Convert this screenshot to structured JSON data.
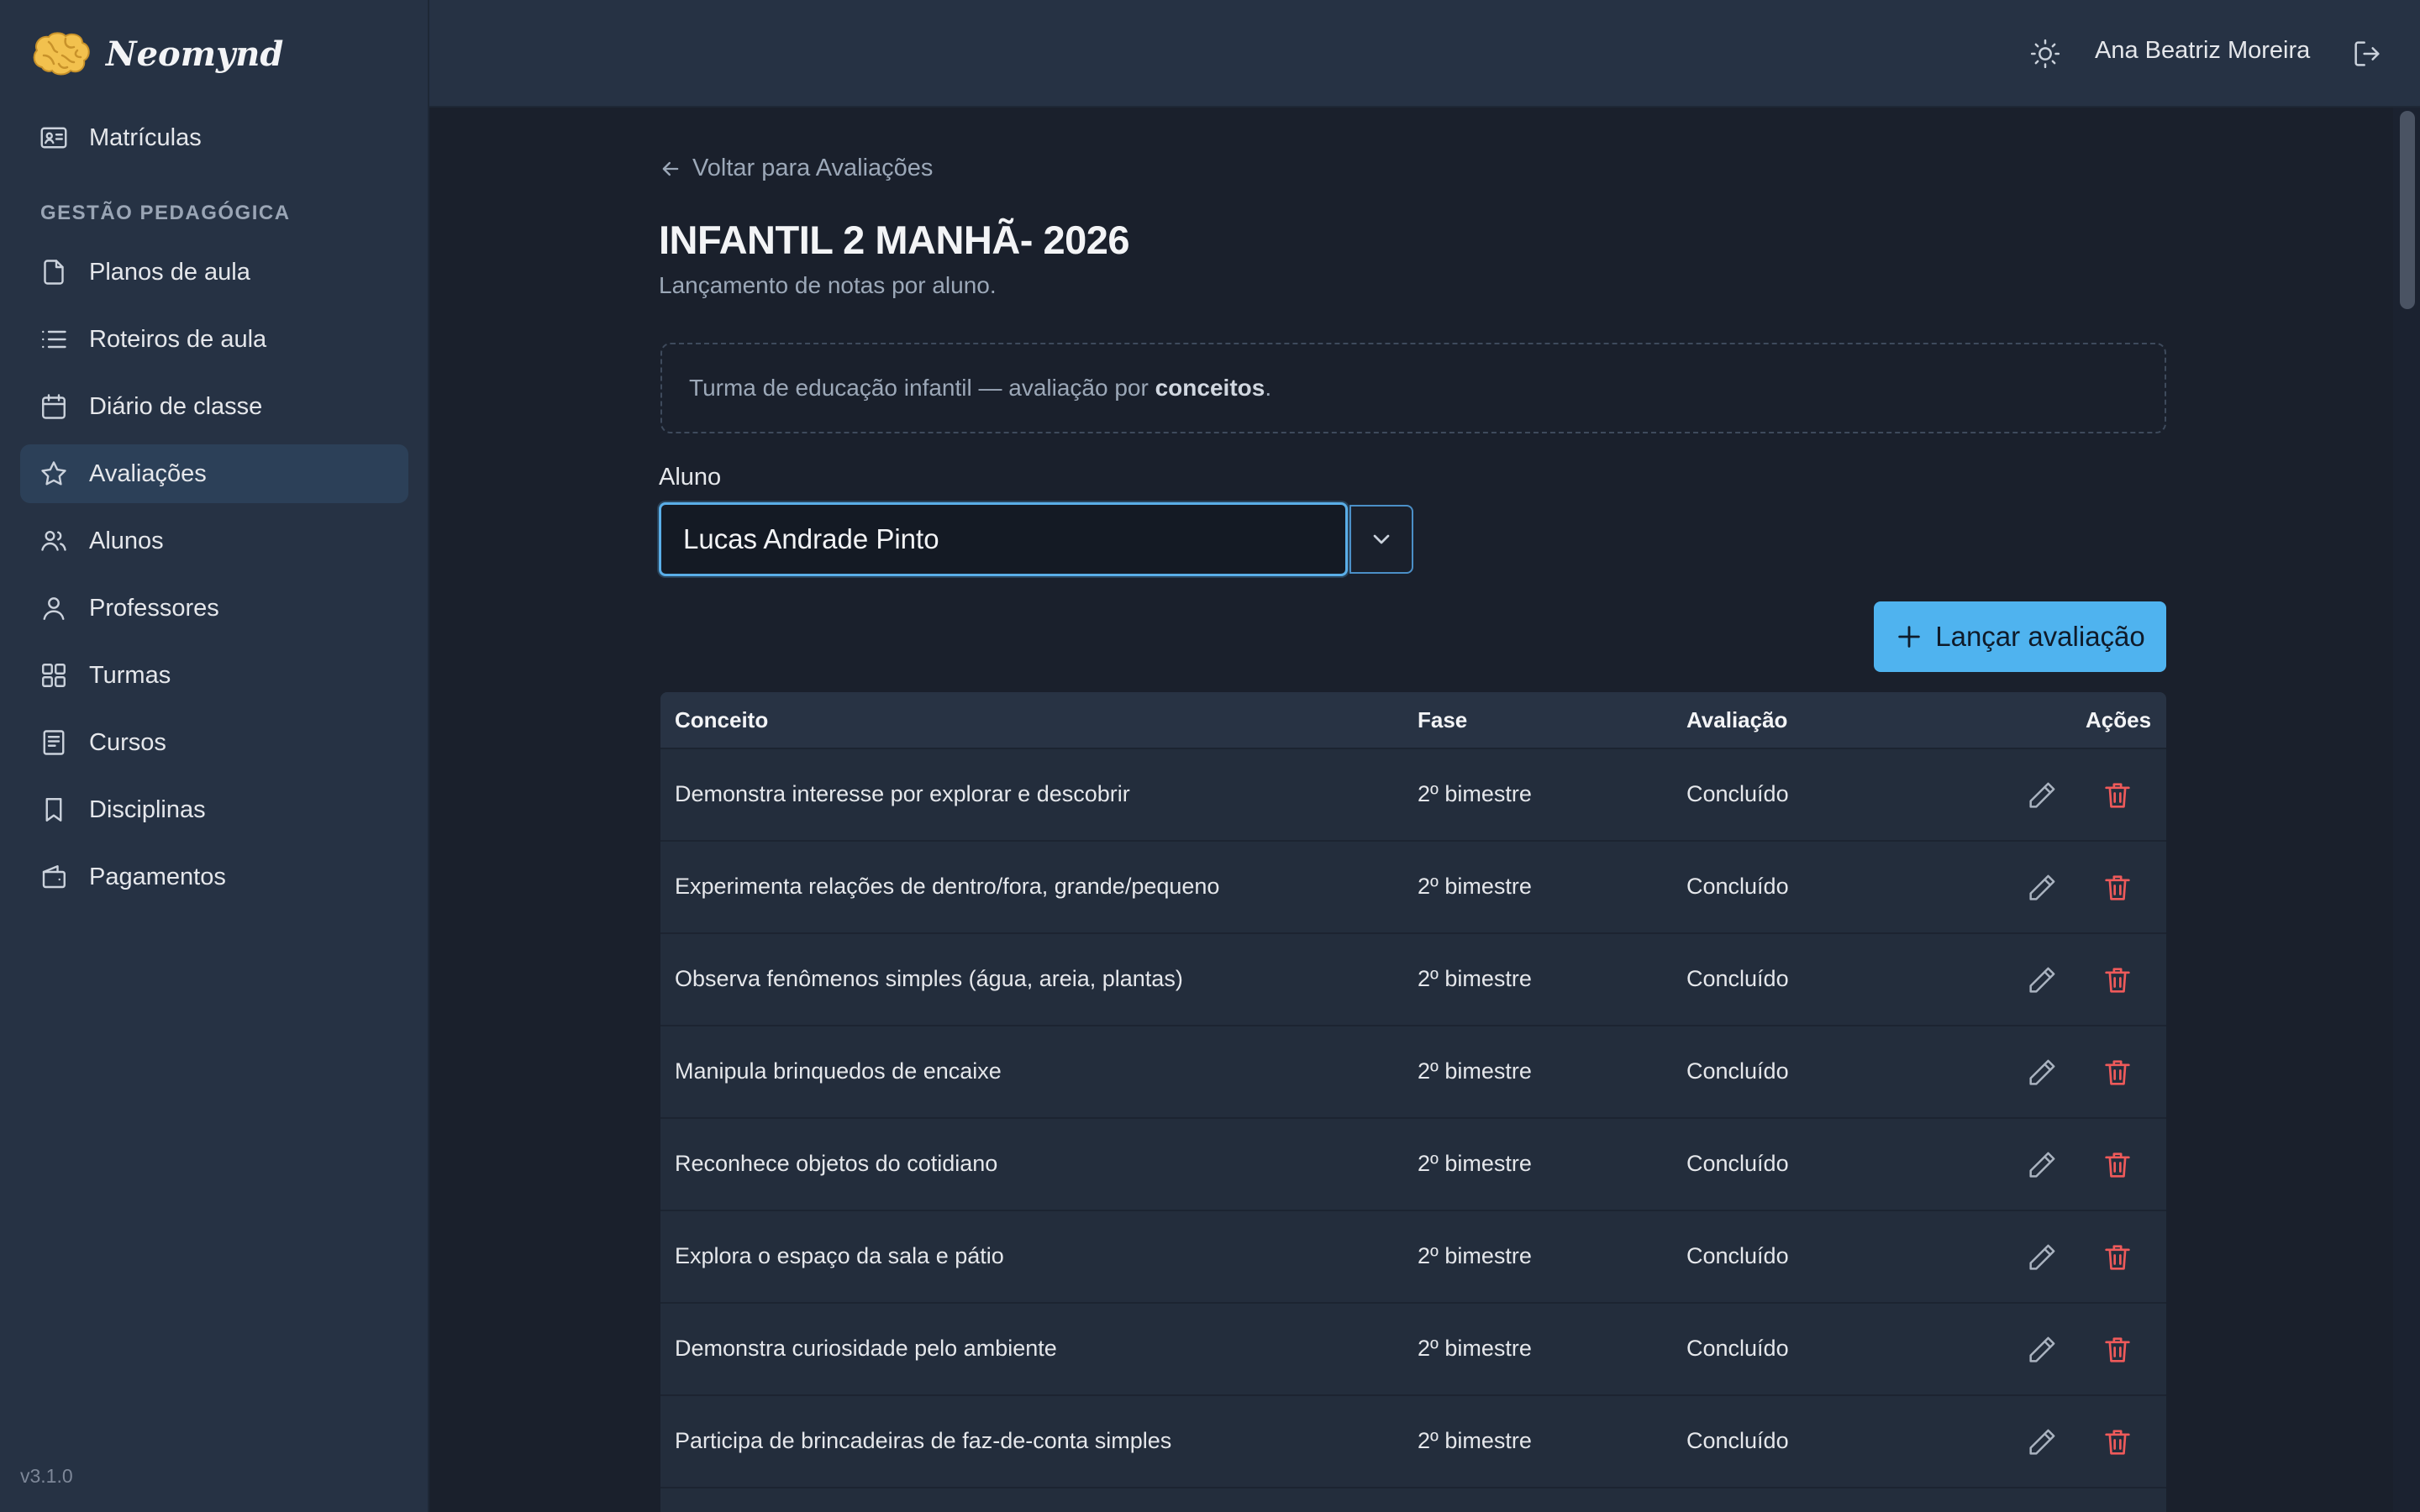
{
  "brand": {
    "name": "Neomynd",
    "logo_icon": "brain-icon"
  },
  "sidebar": {
    "top_items": [
      {
        "label": "Matrículas",
        "icon": "id-card-icon"
      }
    ],
    "section_label": "GESTÃO PEDAGÓGICA",
    "items": [
      {
        "label": "Planos de aula",
        "icon": "file-icon"
      },
      {
        "label": "Roteiros de aula",
        "icon": "list-icon"
      },
      {
        "label": "Diário de classe",
        "icon": "calendar-icon"
      },
      {
        "label": "Avaliações",
        "icon": "star-icon",
        "active": true
      },
      {
        "label": "Alunos",
        "icon": "users-icon"
      },
      {
        "label": "Professores",
        "icon": "user-icon"
      },
      {
        "label": "Turmas",
        "icon": "grid-icon"
      },
      {
        "label": "Cursos",
        "icon": "book-icon"
      },
      {
        "label": "Disciplinas",
        "icon": "bookmark-icon"
      },
      {
        "label": "Pagamentos",
        "icon": "wallet-icon"
      }
    ],
    "version": "v3.1.0"
  },
  "topbar": {
    "theme_icon": "sun-icon",
    "user_name": "Ana Beatriz Moreira",
    "logout_icon": "logout-icon"
  },
  "main": {
    "back_link": "Voltar para Avaliações",
    "title": "INFANTIL 2 MANHÃ- 2026",
    "subtitle": "Lançamento de notas por aluno.",
    "info_prefix": "Turma de educação infantil — avaliação por ",
    "info_bold": "conceitos",
    "info_suffix": ".",
    "student_label": "Aluno",
    "student_value": "Lucas Andrade Pinto",
    "add_button": "Lançar avaliação",
    "table": {
      "headers": {
        "concept": "Conceito",
        "phase": "Fase",
        "evaluation": "Avaliação",
        "actions": "Ações"
      },
      "rows": [
        {
          "concept": "Demonstra interesse por explorar e descobrir",
          "phase": "2º bimestre",
          "evaluation": "Concluído"
        },
        {
          "concept": "Experimenta relações de dentro/fora, grande/pequeno",
          "phase": "2º bimestre",
          "evaluation": "Concluído"
        },
        {
          "concept": "Observa fenômenos simples (água, areia, plantas)",
          "phase": "2º bimestre",
          "evaluation": "Concluído"
        },
        {
          "concept": "Manipula brinquedos de encaixe",
          "phase": "2º bimestre",
          "evaluation": "Concluído"
        },
        {
          "concept": "Reconhece objetos do cotidiano",
          "phase": "2º bimestre",
          "evaluation": "Concluído"
        },
        {
          "concept": "Explora o espaço da sala e pátio",
          "phase": "2º bimestre",
          "evaluation": "Concluído"
        },
        {
          "concept": "Demonstra curiosidade pelo ambiente",
          "phase": "2º bimestre",
          "evaluation": "Concluído"
        },
        {
          "concept": "Participa de brincadeiras de faz-de-conta simples",
          "phase": "2º bimestre",
          "evaluation": "Concluído"
        }
      ]
    }
  },
  "colors": {
    "accent": "#4fb3ef",
    "danger": "#ef5a5a",
    "background": "#1a202c",
    "sidebar": "#263244"
  }
}
